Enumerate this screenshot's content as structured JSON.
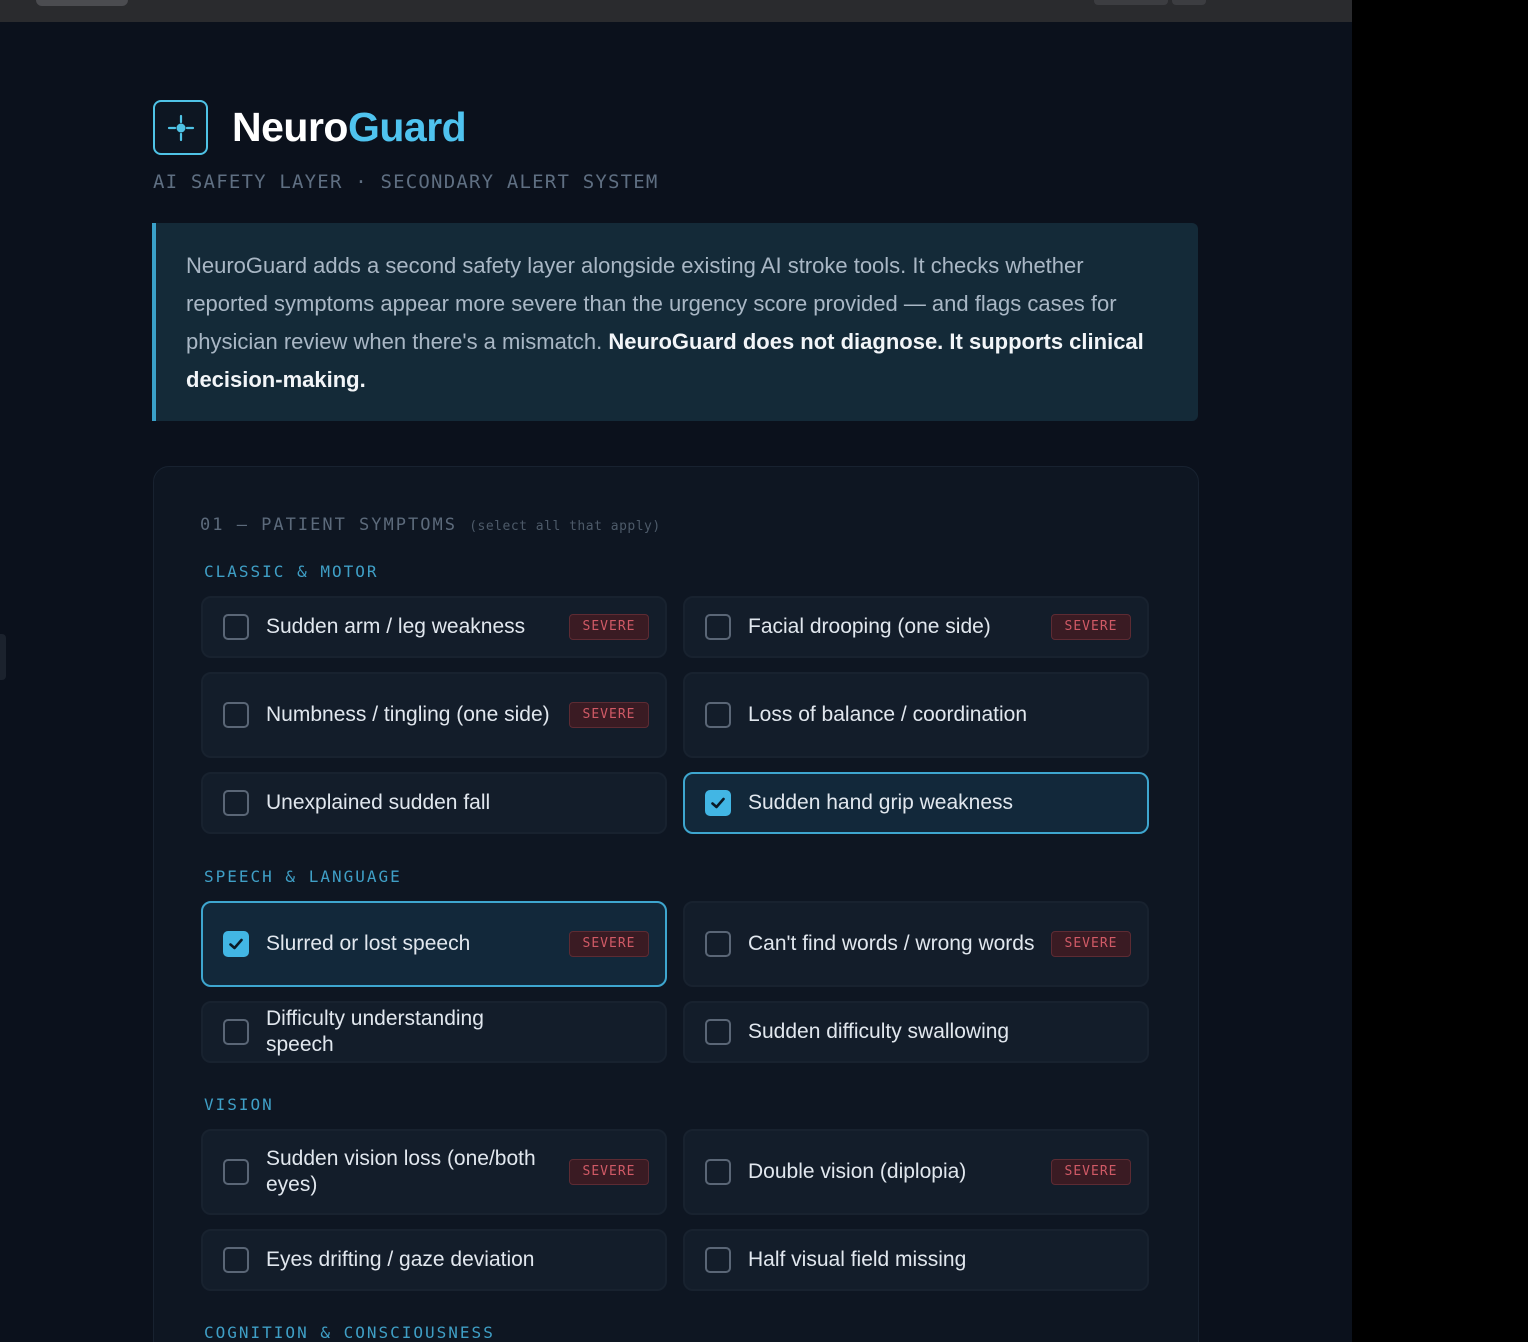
{
  "brand": {
    "name_part1": "Neuro",
    "name_part2": "Guard",
    "tagline": "AI SAFETY LAYER · SECONDARY ALERT SYSTEM",
    "accent_color": "#4fc3ef"
  },
  "intro": {
    "text": "NeuroGuard adds a second safety layer alongside existing AI stroke tools. It checks whether reported symptoms appear more severe than the urgency score provided — and flags cases for physician review when there's a mismatch. ",
    "bold_text": "NeuroGuard does not diagnose. It supports clinical decision-making."
  },
  "symptoms_section": {
    "heading": "01 — PATIENT SYMPTOMS",
    "hint": "(select all that apply)",
    "severe_badge": "SEVERE",
    "groups": [
      {
        "label": "CLASSIC & MOTOR",
        "items": [
          {
            "label": "Sudden arm / leg weakness",
            "severe": true,
            "checked": false
          },
          {
            "label": "Facial drooping (one side)",
            "severe": true,
            "checked": false
          },
          {
            "label": "Numbness / tingling (one side)",
            "severe": true,
            "checked": false
          },
          {
            "label": "Loss of balance / coordination",
            "severe": false,
            "checked": false
          },
          {
            "label": "Unexplained sudden fall",
            "severe": false,
            "checked": false
          },
          {
            "label": "Sudden hand grip weakness",
            "severe": false,
            "checked": true
          }
        ]
      },
      {
        "label": "SPEECH & LANGUAGE",
        "items": [
          {
            "label": "Slurred or lost speech",
            "severe": true,
            "checked": true
          },
          {
            "label": "Can't find words / wrong words",
            "severe": true,
            "checked": false
          },
          {
            "label": "Difficulty understanding speech",
            "severe": false,
            "checked": false
          },
          {
            "label": "Sudden difficulty swallowing",
            "severe": false,
            "checked": false
          }
        ]
      },
      {
        "label": "VISION",
        "items": [
          {
            "label": "Sudden vision loss (one/both eyes)",
            "severe": true,
            "checked": false
          },
          {
            "label": "Double vision (diplopia)",
            "severe": true,
            "checked": false
          },
          {
            "label": "Eyes drifting / gaze deviation",
            "severe": false,
            "checked": false
          },
          {
            "label": "Half visual field missing",
            "severe": false,
            "checked": false
          }
        ]
      },
      {
        "label": "COGNITION & CONSCIOUSNESS",
        "items": []
      }
    ]
  }
}
